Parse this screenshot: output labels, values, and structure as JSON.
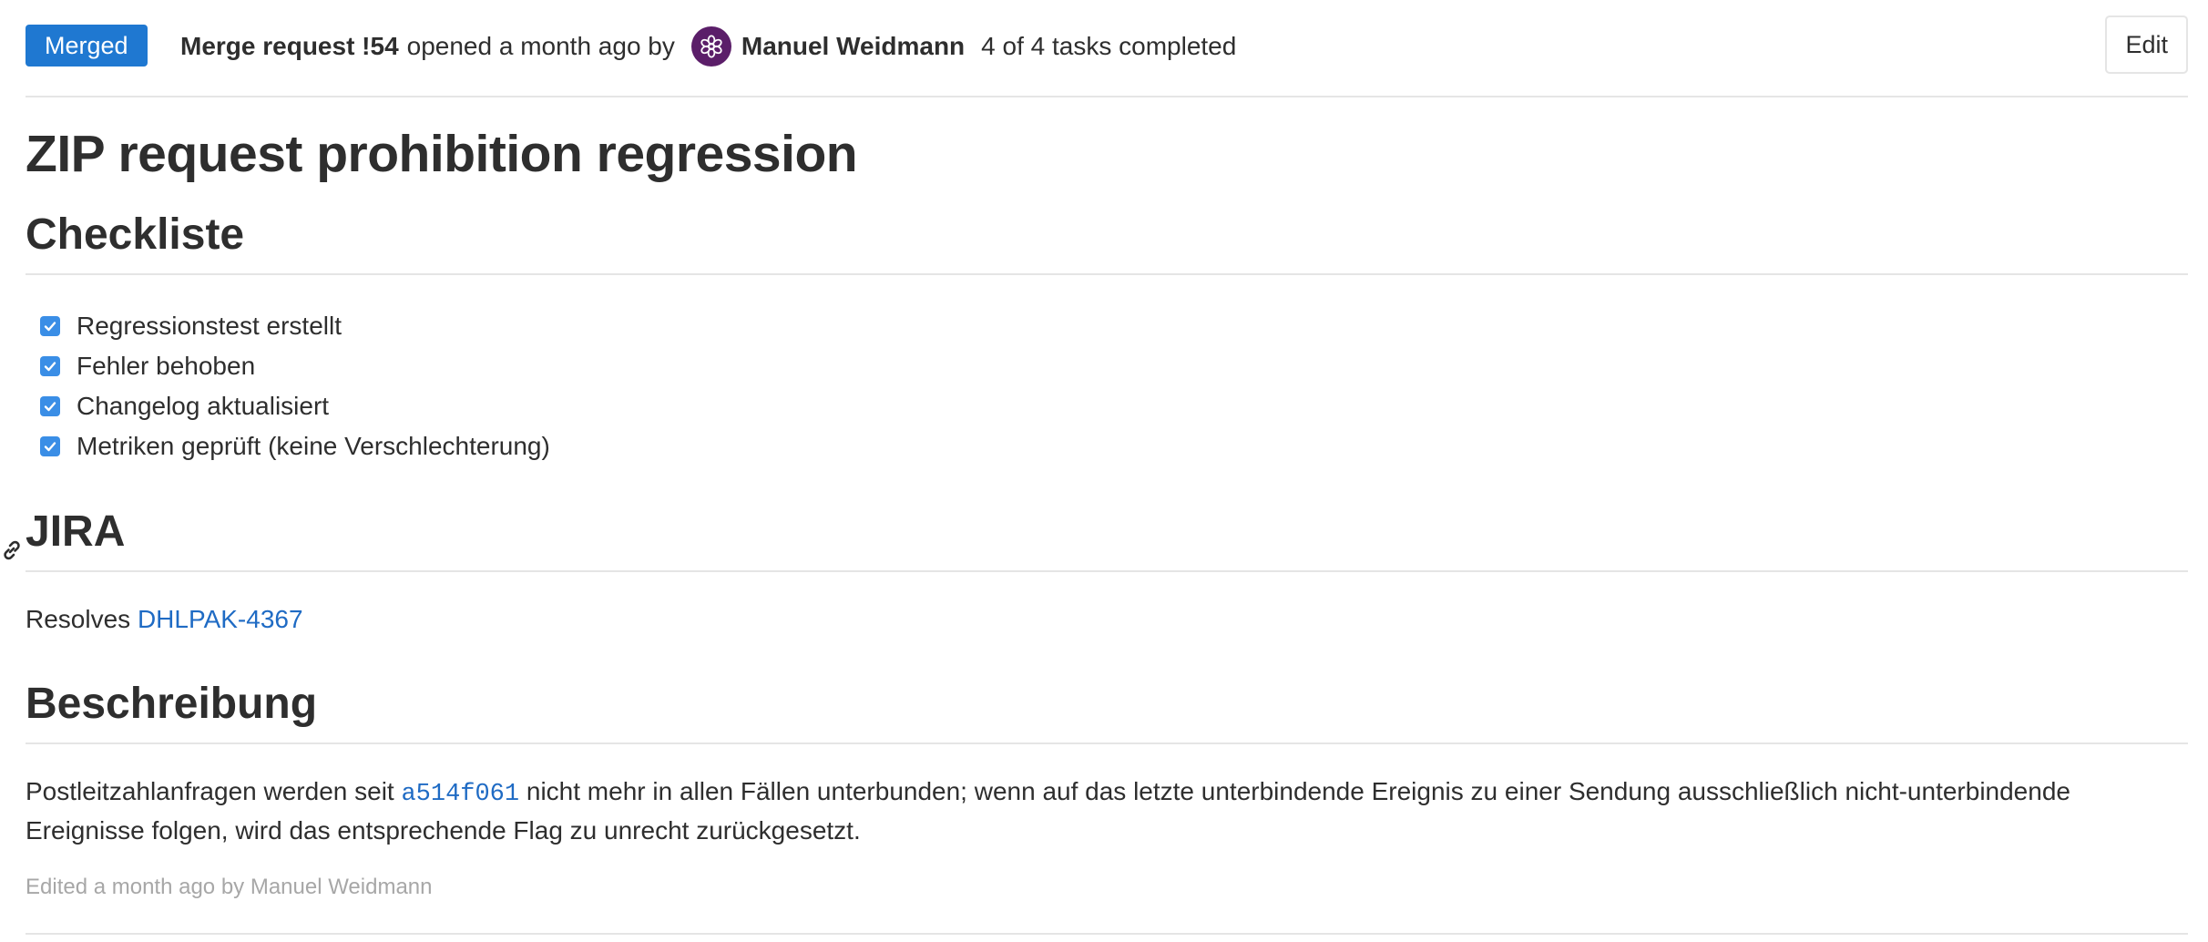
{
  "header": {
    "status": "Merged",
    "mr_ref": "Merge request !54",
    "opened_text": "opened a month ago by",
    "author": "Manuel Weidmann",
    "tasks_status": "4 of 4 tasks completed",
    "edit_label": "Edit"
  },
  "title": "ZIP request prohibition regression",
  "checklist": {
    "heading": "Checkliste",
    "items": [
      {
        "label": "Regressionstest erstellt",
        "checked": true
      },
      {
        "label": "Fehler behoben",
        "checked": true
      },
      {
        "label": "Changelog aktualisiert",
        "checked": true
      },
      {
        "label": "Metriken geprüft (keine Verschlechterung)",
        "checked": true
      }
    ]
  },
  "jira": {
    "heading": "JIRA",
    "prefix": "Resolves",
    "issue_link": "DHLPAK-4367"
  },
  "description": {
    "heading": "Beschreibung",
    "text_before": "Postleitzahlanfragen werden seit",
    "commit_link": "a514f061",
    "text_after": "nicht mehr in allen Fällen unterbunden; wenn auf das letzte unterbindende Ereignis zu einer Sendung ausschließlich nicht-unterbindende Ereignisse folgen, wird das entsprechende Flag zu unrecht zurückgesetzt."
  },
  "edited_note": "Edited a month ago by Manuel Weidmann",
  "colors": {
    "merged_badge": "#1f78d1",
    "link": "#1f6bc4",
    "checkbox": "#3a8ee6",
    "avatar_bg": "#5b1e69"
  },
  "icons": {
    "avatar": "flower-avatar-icon",
    "anchor": "link-icon",
    "checkbox": "checkmark-icon"
  }
}
